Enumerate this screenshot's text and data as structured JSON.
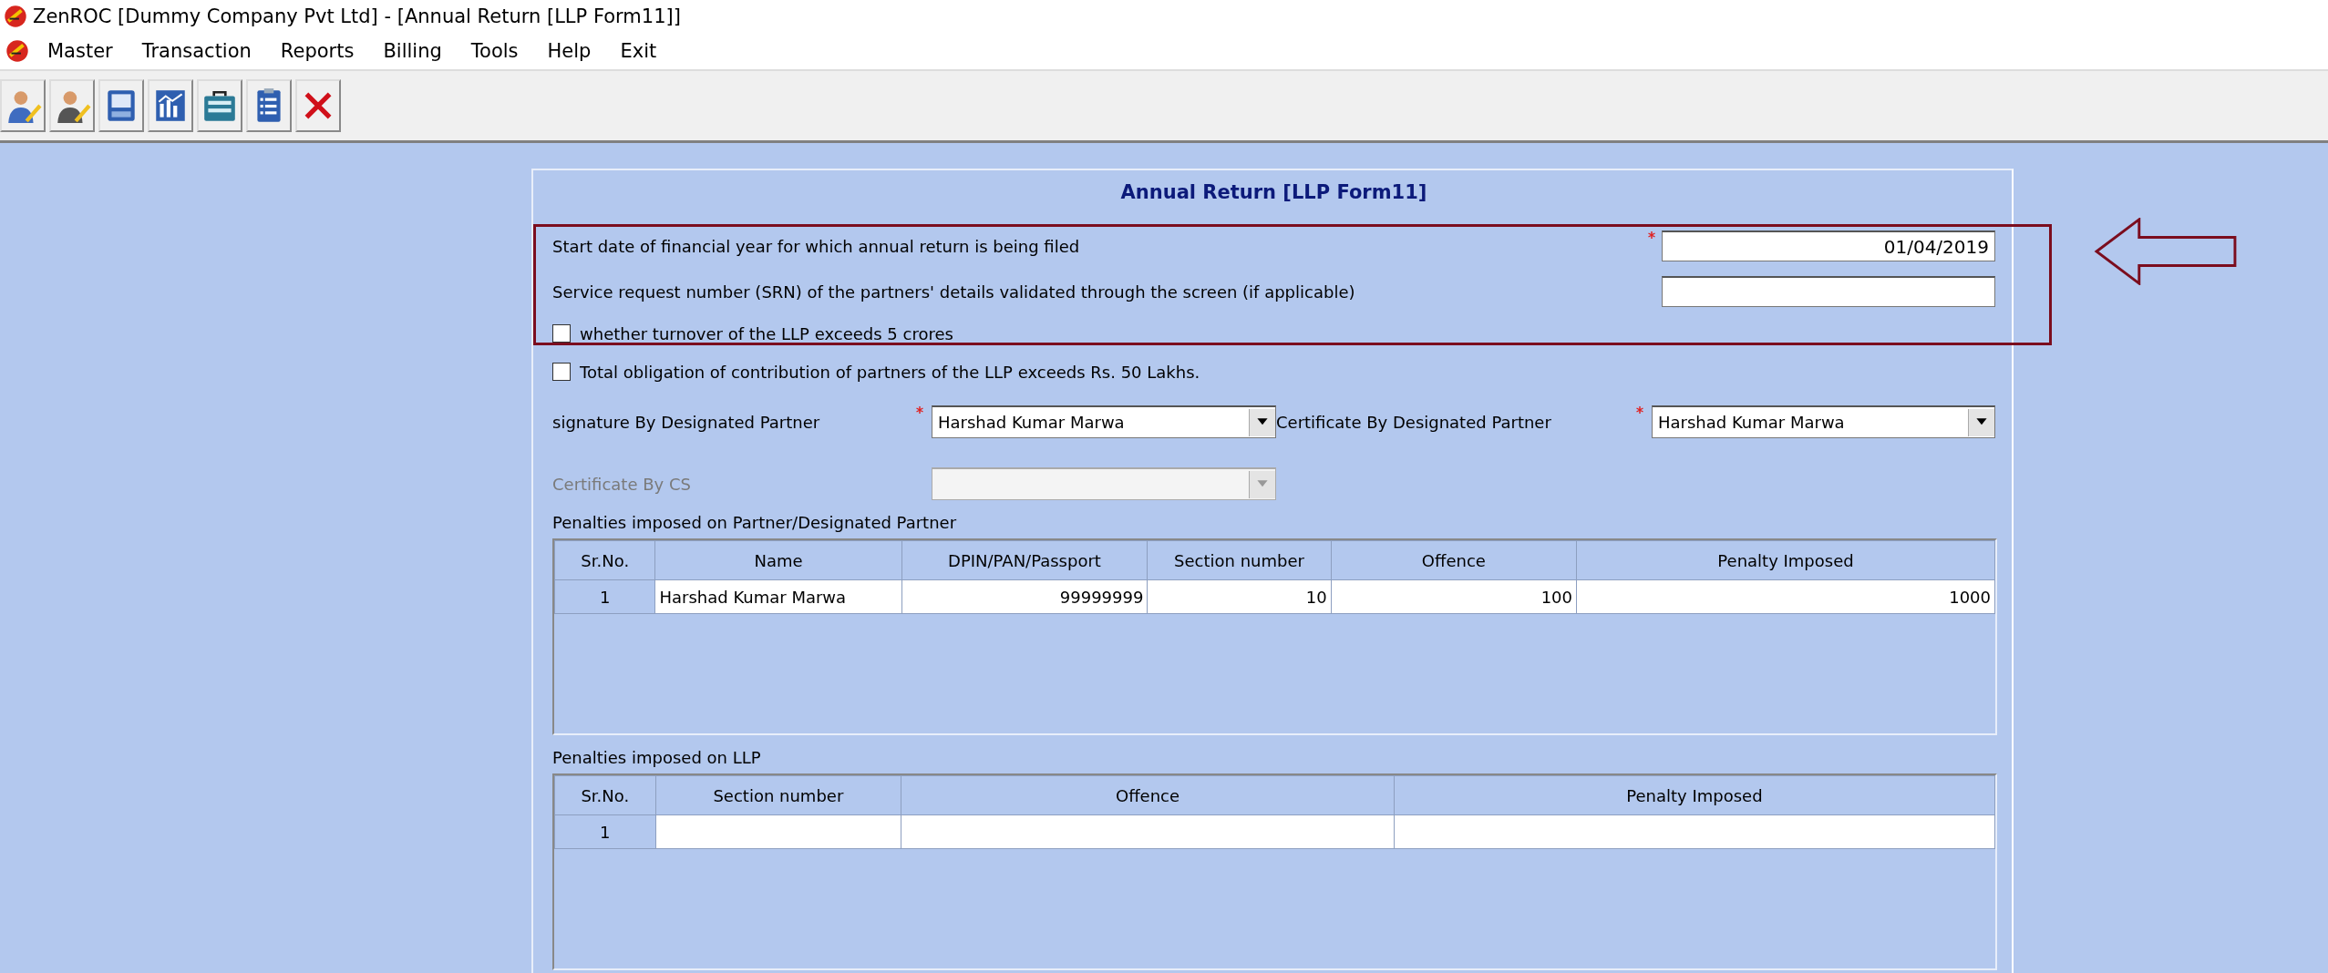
{
  "window": {
    "title": "ZenROC [Dummy Company Pvt Ltd] - [Annual Return [LLP Form11]]"
  },
  "menu": [
    {
      "label": "Master"
    },
    {
      "label": "Transaction"
    },
    {
      "label": "Reports"
    },
    {
      "label": "Billing"
    },
    {
      "label": "Tools"
    },
    {
      "label": "Help"
    },
    {
      "label": "Exit"
    }
  ],
  "toolbar": [
    {
      "kind": "user-edit"
    },
    {
      "kind": "user-edit-dark"
    },
    {
      "kind": "document"
    },
    {
      "kind": "chart"
    },
    {
      "kind": "briefcase"
    },
    {
      "kind": "checklist"
    },
    {
      "kind": "close"
    }
  ],
  "form": {
    "title": "Annual Return [LLP Form11]",
    "fields": [
      {
        "label": "Start date of financial year for which annual return is being filed",
        "required": true,
        "value": "01/04/2019"
      },
      {
        "label": "Service request number (SRN) of the partners' details validated through the screen (if applicable)",
        "required": false
      }
    ],
    "checkboxes": [
      {
        "label": "whether turnover of the LLP exceeds 5 crores",
        "checked": false
      },
      {
        "label": "Total obligation of contribution of partners of the LLP exceeds Rs. 50 Lakhs.",
        "checked": false
      }
    ],
    "selects": [
      {
        "label": "signature By Designated Partner",
        "required": true,
        "value": "Harshad Kumar Marwa",
        "disabled": false
      },
      {
        "label": "Certificate By Designated Partner",
        "required": true,
        "value": "Harshad Kumar Marwa",
        "disabled": false
      },
      {
        "label": "Certificate By CS",
        "required": false,
        "disabled": true
      }
    ],
    "tables": [
      {
        "caption": "Penalties imposed on Partner/Designated Partner",
        "columns": [
          "Sr.No.",
          "Name",
          "DPIN/PAN/Passport",
          "Section number",
          "Offence",
          "Penalty Imposed"
        ],
        "rows": [
          [
            "1",
            "Harshad Kumar Marwa",
            "99999999",
            "10",
            "100",
            "1000"
          ]
        ]
      },
      {
        "caption": "Penalties imposed on LLP",
        "columns": [
          "Sr.No.",
          "Section number",
          "Offence",
          "Penalty Imposed"
        ],
        "rows": [
          [
            "1",
            "",
            "",
            ""
          ]
        ]
      }
    ]
  }
}
